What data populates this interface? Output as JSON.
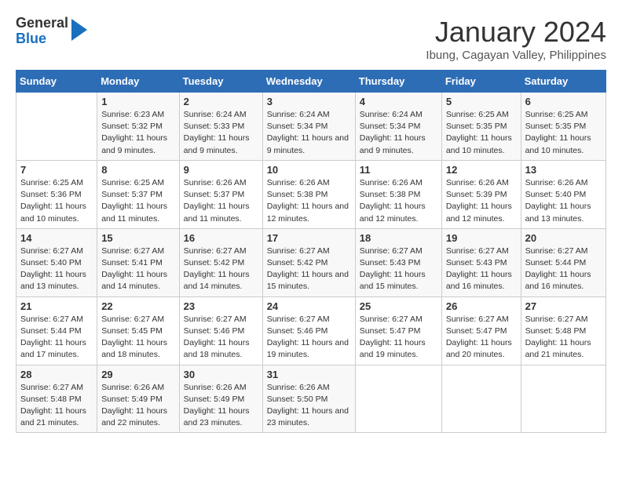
{
  "header": {
    "logo": {
      "general": "General",
      "blue": "Blue"
    },
    "title": "January 2024",
    "location": "Ibung, Cagayan Valley, Philippines"
  },
  "weekdays": [
    "Sunday",
    "Monday",
    "Tuesday",
    "Wednesday",
    "Thursday",
    "Friday",
    "Saturday"
  ],
  "weeks": [
    [
      {
        "day": "",
        "sunrise": "",
        "sunset": "",
        "daylight": ""
      },
      {
        "day": "1",
        "sunrise": "Sunrise: 6:23 AM",
        "sunset": "Sunset: 5:32 PM",
        "daylight": "Daylight: 11 hours and 9 minutes."
      },
      {
        "day": "2",
        "sunrise": "Sunrise: 6:24 AM",
        "sunset": "Sunset: 5:33 PM",
        "daylight": "Daylight: 11 hours and 9 minutes."
      },
      {
        "day": "3",
        "sunrise": "Sunrise: 6:24 AM",
        "sunset": "Sunset: 5:34 PM",
        "daylight": "Daylight: 11 hours and 9 minutes."
      },
      {
        "day": "4",
        "sunrise": "Sunrise: 6:24 AM",
        "sunset": "Sunset: 5:34 PM",
        "daylight": "Daylight: 11 hours and 9 minutes."
      },
      {
        "day": "5",
        "sunrise": "Sunrise: 6:25 AM",
        "sunset": "Sunset: 5:35 PM",
        "daylight": "Daylight: 11 hours and 10 minutes."
      },
      {
        "day": "6",
        "sunrise": "Sunrise: 6:25 AM",
        "sunset": "Sunset: 5:35 PM",
        "daylight": "Daylight: 11 hours and 10 minutes."
      }
    ],
    [
      {
        "day": "7",
        "sunrise": "Sunrise: 6:25 AM",
        "sunset": "Sunset: 5:36 PM",
        "daylight": "Daylight: 11 hours and 10 minutes."
      },
      {
        "day": "8",
        "sunrise": "Sunrise: 6:25 AM",
        "sunset": "Sunset: 5:37 PM",
        "daylight": "Daylight: 11 hours and 11 minutes."
      },
      {
        "day": "9",
        "sunrise": "Sunrise: 6:26 AM",
        "sunset": "Sunset: 5:37 PM",
        "daylight": "Daylight: 11 hours and 11 minutes."
      },
      {
        "day": "10",
        "sunrise": "Sunrise: 6:26 AM",
        "sunset": "Sunset: 5:38 PM",
        "daylight": "Daylight: 11 hours and 12 minutes."
      },
      {
        "day": "11",
        "sunrise": "Sunrise: 6:26 AM",
        "sunset": "Sunset: 5:38 PM",
        "daylight": "Daylight: 11 hours and 12 minutes."
      },
      {
        "day": "12",
        "sunrise": "Sunrise: 6:26 AM",
        "sunset": "Sunset: 5:39 PM",
        "daylight": "Daylight: 11 hours and 12 minutes."
      },
      {
        "day": "13",
        "sunrise": "Sunrise: 6:26 AM",
        "sunset": "Sunset: 5:40 PM",
        "daylight": "Daylight: 11 hours and 13 minutes."
      }
    ],
    [
      {
        "day": "14",
        "sunrise": "Sunrise: 6:27 AM",
        "sunset": "Sunset: 5:40 PM",
        "daylight": "Daylight: 11 hours and 13 minutes."
      },
      {
        "day": "15",
        "sunrise": "Sunrise: 6:27 AM",
        "sunset": "Sunset: 5:41 PM",
        "daylight": "Daylight: 11 hours and 14 minutes."
      },
      {
        "day": "16",
        "sunrise": "Sunrise: 6:27 AM",
        "sunset": "Sunset: 5:42 PM",
        "daylight": "Daylight: 11 hours and 14 minutes."
      },
      {
        "day": "17",
        "sunrise": "Sunrise: 6:27 AM",
        "sunset": "Sunset: 5:42 PM",
        "daylight": "Daylight: 11 hours and 15 minutes."
      },
      {
        "day": "18",
        "sunrise": "Sunrise: 6:27 AM",
        "sunset": "Sunset: 5:43 PM",
        "daylight": "Daylight: 11 hours and 15 minutes."
      },
      {
        "day": "19",
        "sunrise": "Sunrise: 6:27 AM",
        "sunset": "Sunset: 5:43 PM",
        "daylight": "Daylight: 11 hours and 16 minutes."
      },
      {
        "day": "20",
        "sunrise": "Sunrise: 6:27 AM",
        "sunset": "Sunset: 5:44 PM",
        "daylight": "Daylight: 11 hours and 16 minutes."
      }
    ],
    [
      {
        "day": "21",
        "sunrise": "Sunrise: 6:27 AM",
        "sunset": "Sunset: 5:44 PM",
        "daylight": "Daylight: 11 hours and 17 minutes."
      },
      {
        "day": "22",
        "sunrise": "Sunrise: 6:27 AM",
        "sunset": "Sunset: 5:45 PM",
        "daylight": "Daylight: 11 hours and 18 minutes."
      },
      {
        "day": "23",
        "sunrise": "Sunrise: 6:27 AM",
        "sunset": "Sunset: 5:46 PM",
        "daylight": "Daylight: 11 hours and 18 minutes."
      },
      {
        "day": "24",
        "sunrise": "Sunrise: 6:27 AM",
        "sunset": "Sunset: 5:46 PM",
        "daylight": "Daylight: 11 hours and 19 minutes."
      },
      {
        "day": "25",
        "sunrise": "Sunrise: 6:27 AM",
        "sunset": "Sunset: 5:47 PM",
        "daylight": "Daylight: 11 hours and 19 minutes."
      },
      {
        "day": "26",
        "sunrise": "Sunrise: 6:27 AM",
        "sunset": "Sunset: 5:47 PM",
        "daylight": "Daylight: 11 hours and 20 minutes."
      },
      {
        "day": "27",
        "sunrise": "Sunrise: 6:27 AM",
        "sunset": "Sunset: 5:48 PM",
        "daylight": "Daylight: 11 hours and 21 minutes."
      }
    ],
    [
      {
        "day": "28",
        "sunrise": "Sunrise: 6:27 AM",
        "sunset": "Sunset: 5:48 PM",
        "daylight": "Daylight: 11 hours and 21 minutes."
      },
      {
        "day": "29",
        "sunrise": "Sunrise: 6:26 AM",
        "sunset": "Sunset: 5:49 PM",
        "daylight": "Daylight: 11 hours and 22 minutes."
      },
      {
        "day": "30",
        "sunrise": "Sunrise: 6:26 AM",
        "sunset": "Sunset: 5:49 PM",
        "daylight": "Daylight: 11 hours and 23 minutes."
      },
      {
        "day": "31",
        "sunrise": "Sunrise: 6:26 AM",
        "sunset": "Sunset: 5:50 PM",
        "daylight": "Daylight: 11 hours and 23 minutes."
      },
      {
        "day": "",
        "sunrise": "",
        "sunset": "",
        "daylight": ""
      },
      {
        "day": "",
        "sunrise": "",
        "sunset": "",
        "daylight": ""
      },
      {
        "day": "",
        "sunrise": "",
        "sunset": "",
        "daylight": ""
      }
    ]
  ]
}
